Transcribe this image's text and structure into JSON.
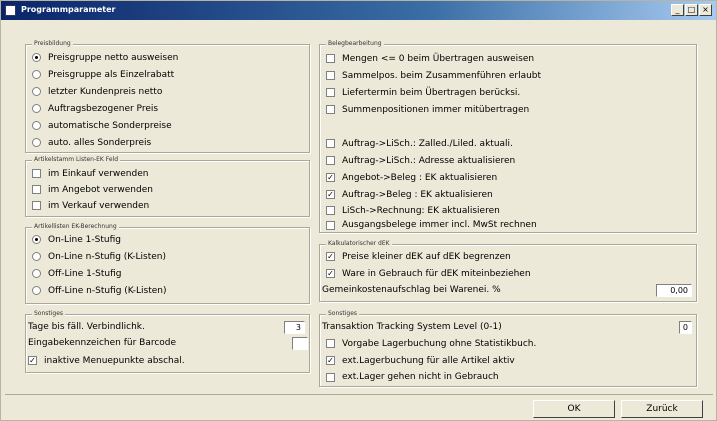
{
  "window": {
    "title": "Programmparameter",
    "minimize": "_",
    "maximize": "□",
    "close": "×"
  },
  "preisbildung": {
    "title": "Preisbildung",
    "options": [
      {
        "label": "Preisgruppe netto ausweisen",
        "checked": true
      },
      {
        "label": "Preisgruppe als Einzelrabatt",
        "checked": false
      },
      {
        "label": "letzter Kundenpreis netto",
        "checked": false
      },
      {
        "label": "Auftragsbezogener Preis",
        "checked": false
      },
      {
        "label": "automatische Sonderpreise",
        "checked": false
      },
      {
        "label": "auto. alles Sonderpreis",
        "checked": false
      }
    ]
  },
  "artikelstamm": {
    "title": "Artikelstamm Listen-EK Feld",
    "options": [
      {
        "label": "im Einkauf verwenden",
        "checked": false
      },
      {
        "label": "im Angebot verwenden",
        "checked": false
      },
      {
        "label": "im Verkauf verwenden",
        "checked": false
      }
    ]
  },
  "ek_berechnung": {
    "title": "Artikellisten EK-Berechnung",
    "options": [
      {
        "label": "On-Line 1-Stufig",
        "checked": true
      },
      {
        "label": "On-Line n-Stufig  (K-Listen)",
        "checked": false
      },
      {
        "label": "Off-Line 1-Stufig",
        "checked": false
      },
      {
        "label": "Off-Line n-Stufig (K-Listen)",
        "checked": false
      }
    ]
  },
  "sonstiges_left": {
    "title": "Sonstiges",
    "tage_label": "Tage bis fäll. Verbindlichk.",
    "tage_value": "3",
    "barcode_label": "Eingabekennzeichen für Barcode",
    "barcode_value": "",
    "inaktive_label": "inaktive Menuepunkte abschal.",
    "inaktive_checked": true
  },
  "belegbearbeitung": {
    "title": "Belegbearbeitung",
    "options": [
      {
        "label": "Mengen <= 0 beim Übertragen ausweisen",
        "checked": false
      },
      {
        "label": "Sammelpos. beim Zusammenführen erlaubt",
        "checked": false
      },
      {
        "label": "Liefertermin beim Übertragen berücksi.",
        "checked": false
      },
      {
        "label": "Summenpositionen immer mitübertragen",
        "checked": false
      },
      {
        "label": "Auftrag->LiSch.: Zalled./Liled. aktuali.",
        "checked": false
      },
      {
        "label": "Auftrag->LiSch.: Adresse aktualisieren",
        "checked": false
      },
      {
        "label": "Angebot->Beleg : EK aktualisieren",
        "checked": true
      },
      {
        "label": "Auftrag->Beleg : EK aktualisieren",
        "checked": true
      },
      {
        "label": "LiSch->Rechnung: EK aktualisieren",
        "checked": false
      },
      {
        "label": "Ausgangsbelege immer incl. MwSt rechnen",
        "checked": false
      }
    ]
  },
  "kalkulatorischer": {
    "title": "Kalkulatorischer dEK",
    "options": [
      {
        "label": "Preise kleiner dEK auf dEK begrenzen",
        "checked": true
      },
      {
        "label": "Ware in Gebrauch für dEK miteinbeziehen",
        "checked": true
      }
    ],
    "gemein_label": "Gemeinkostenaufschlag bei Warenei. %",
    "gemein_value": "0,00"
  },
  "sonstiges_right": {
    "title": "Sonstiges",
    "tracking_label": "Transaktion Tracking System Level    (0-1)",
    "tracking_value": "0",
    "options": [
      {
        "label": "Vorgabe Lagerbuchung ohne Statistikbuch.",
        "checked": false
      },
      {
        "label": "ext.Lagerbuchung für alle Artikel aktiv",
        "checked": true
      },
      {
        "label": "ext.Lager gehen nicht in Gebrauch",
        "checked": false
      }
    ]
  },
  "buttons": {
    "ok": "OK",
    "zurueck": "Zurück"
  }
}
